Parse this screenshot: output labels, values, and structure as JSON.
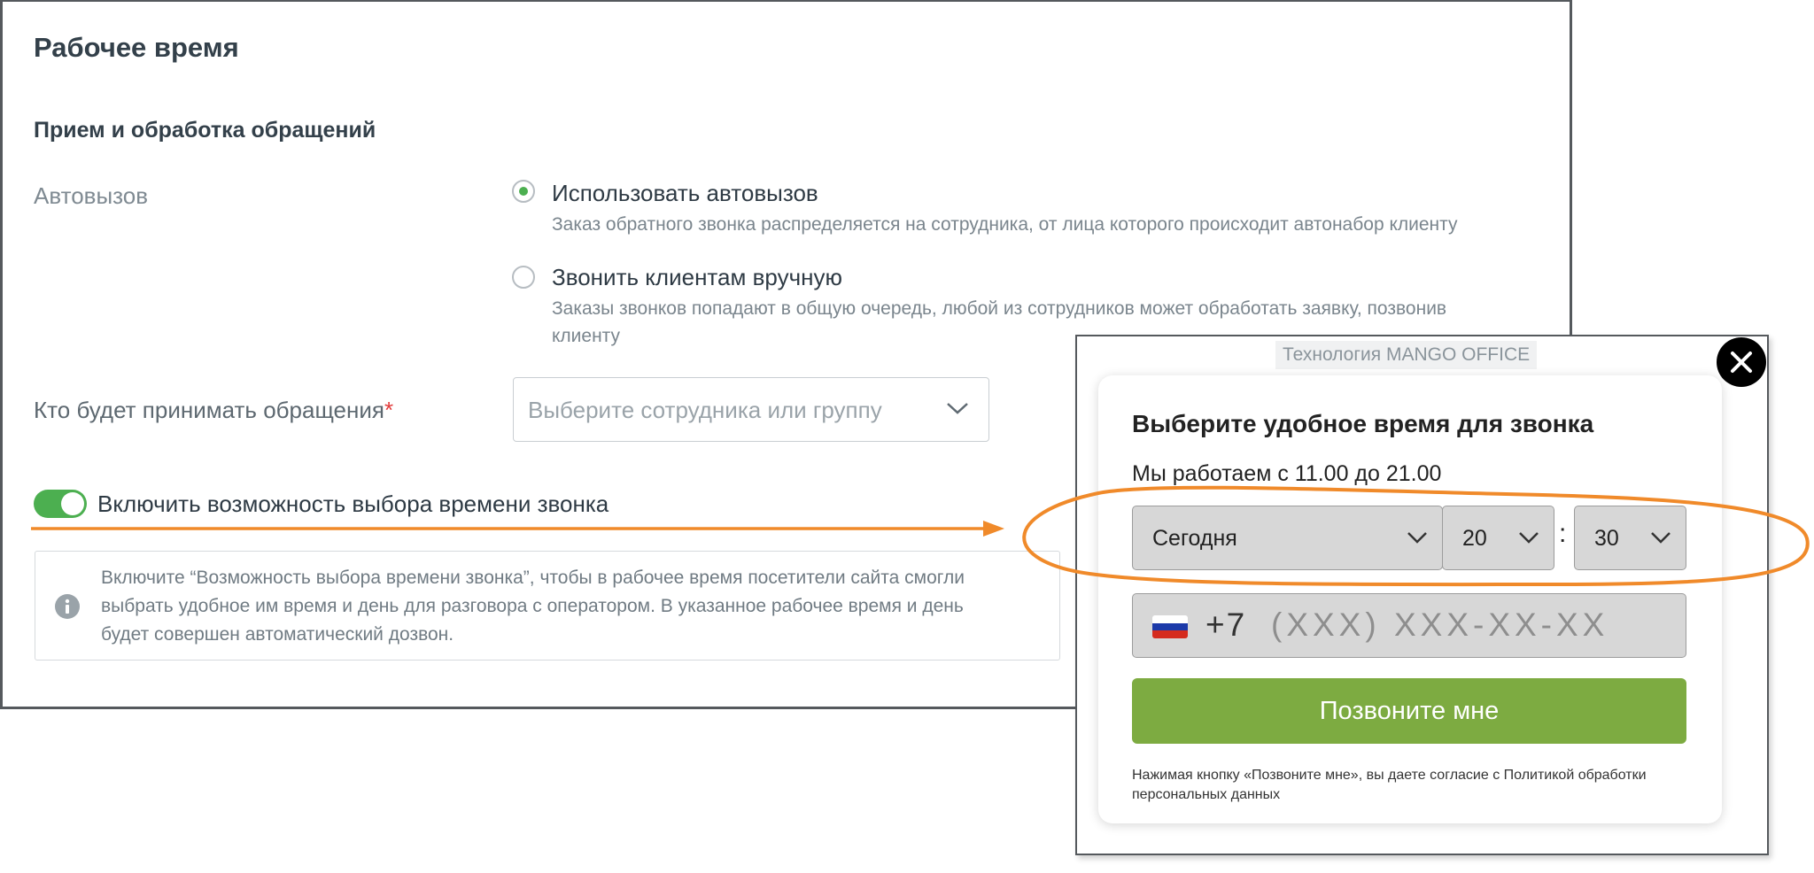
{
  "settings": {
    "page_title": "Рабочее время",
    "section_title": "Прием и обработка обращений",
    "autodial_label": "Автовызов",
    "option_auto": {
      "title": "Использовать автовызов",
      "description": "Заказ обратного звонка распределяется на сотрудника, от лица которого происходит автонабор клиенту",
      "selected": true
    },
    "option_manual": {
      "title": "Звонить клиентам вручную",
      "description": "Заказы звонков попадают в общую очередь, любой из сотрудников может обработать заявку, позвонив клиенту",
      "selected": false
    },
    "receiver_label": "Кто будет принимать обращения",
    "required_mark": "*",
    "receiver_placeholder": "Выберите сотрудника или группу",
    "toggle_label": "Включить возможность выбора времени звонка",
    "toggle_on": true,
    "info_text": "Включите “Возможность выбора времени звонка”, чтобы в рабочее время посетители сайта смогли\nвыбрать удобное им время и день для разговора с оператором. В указанное рабочее время и день\nбудет совершен автоматический дозвон."
  },
  "widget": {
    "badge": "Технология MANGO OFFICE",
    "title": "Выберите удобное время для звонка",
    "hours": "Мы работаем с 11.00 до 21.00",
    "day": "Сегодня",
    "hour": "20",
    "colon": ":",
    "minute": "30",
    "phone_code": "+7",
    "phone_mask": "(XXX) XXX-XX-XX",
    "call_button": "Позвоните мне",
    "consent": "Нажимая кнопку «Позвоните мне», вы даете согласие с Политикой обработки персональных данных"
  },
  "colors": {
    "accent_green": "#4caf50",
    "call_button": "#7dab41",
    "highlight_orange": "#f08a2a",
    "required": "#e23b3b"
  }
}
